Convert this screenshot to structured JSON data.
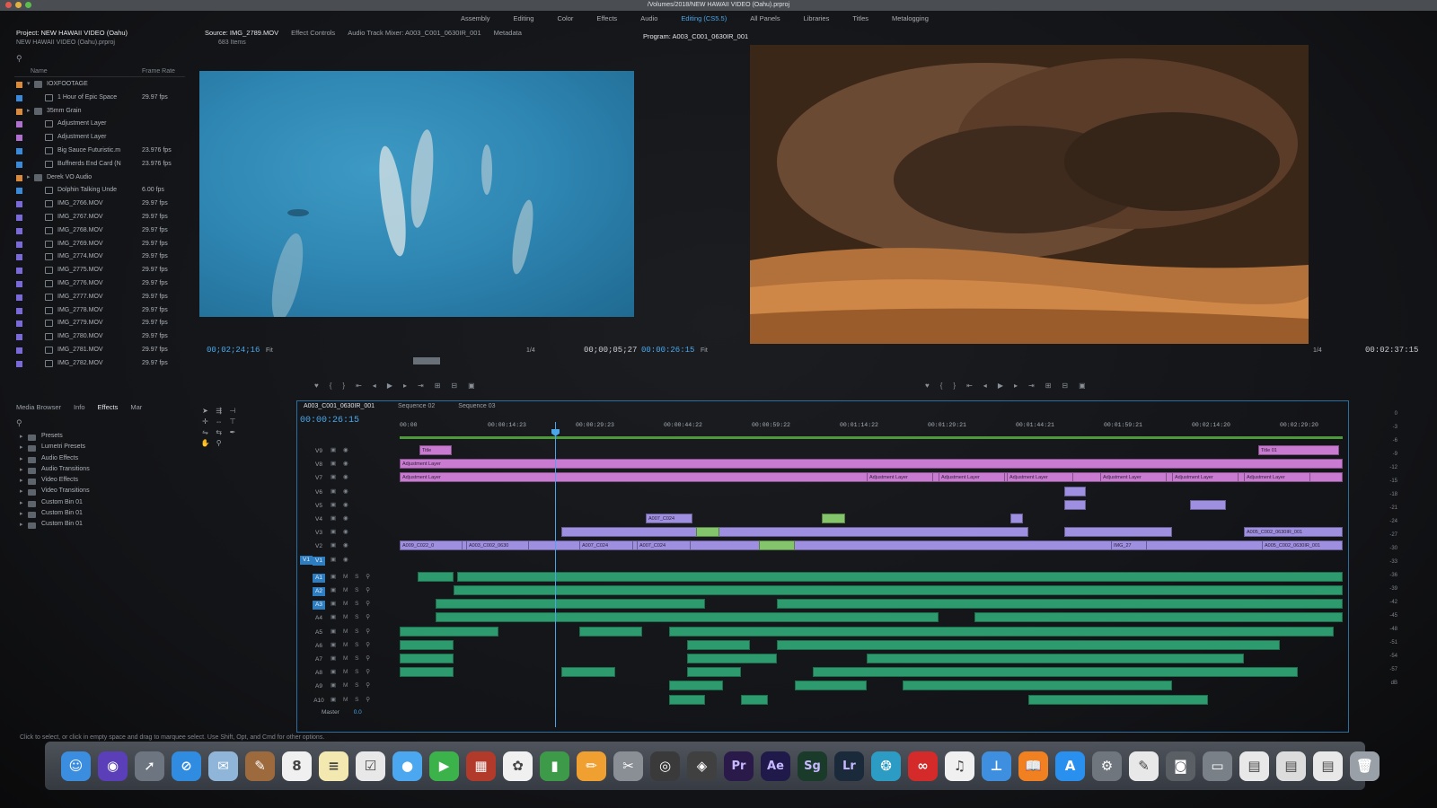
{
  "window": {
    "title": "/Volumes/2018/NEW HAWAII VIDEO (Oahu).prproj"
  },
  "workspaces": [
    "Assembly",
    "Editing",
    "Color",
    "Effects",
    "Audio",
    "Editing (CS5.5)",
    "All Panels",
    "Libraries",
    "Titles",
    "Metalogging"
  ],
  "workspace_active": "Editing (CS5.5)",
  "project": {
    "tab": "Project: NEW HAWAII VIDEO (Oahu)",
    "file": "NEW HAWAII VIDEO (Oahu).prproj",
    "count": "683 Items",
    "col_name": "Name",
    "col_rate": "Frame Rate",
    "items": [
      {
        "name": "IOXFOOTAGE",
        "rate": "",
        "color": "#d98a3a",
        "kind": "bin"
      },
      {
        "name": "1 Hour of Epic Space",
        "rate": "29.97 fps",
        "color": "#3a8ad9",
        "kind": "seq"
      },
      {
        "name": "35mm Grain",
        "rate": "",
        "color": "#d98a3a",
        "kind": "bin"
      },
      {
        "name": "Adjustment Layer",
        "rate": "",
        "color": "#b070d0",
        "kind": "clip"
      },
      {
        "name": "Adjustment Layer",
        "rate": "",
        "color": "#b070d0",
        "kind": "clip"
      },
      {
        "name": "Big Sauce Futuristic.m",
        "rate": "23.976 fps",
        "color": "#3a8ad9",
        "kind": "clip"
      },
      {
        "name": "Buffnerds End Card (N",
        "rate": "23.976 fps",
        "color": "#3a8ad9",
        "kind": "seq"
      },
      {
        "name": "Derek VO Audio",
        "rate": "",
        "color": "#d98a3a",
        "kind": "bin"
      },
      {
        "name": "Dolphin Talking Unde",
        "rate": "6.00 fps",
        "color": "#3a8ad9",
        "kind": "seq"
      },
      {
        "name": "IMG_2766.MOV",
        "rate": "29.97 fps",
        "color": "#7a6ad9",
        "kind": "clip"
      },
      {
        "name": "IMG_2767.MOV",
        "rate": "29.97 fps",
        "color": "#7a6ad9",
        "kind": "clip"
      },
      {
        "name": "IMG_2768.MOV",
        "rate": "29.97 fps",
        "color": "#7a6ad9",
        "kind": "clip"
      },
      {
        "name": "IMG_2769.MOV",
        "rate": "29.97 fps",
        "color": "#7a6ad9",
        "kind": "clip"
      },
      {
        "name": "IMG_2774.MOV",
        "rate": "29.97 fps",
        "color": "#7a6ad9",
        "kind": "clip"
      },
      {
        "name": "IMG_2775.MOV",
        "rate": "29.97 fps",
        "color": "#7a6ad9",
        "kind": "clip"
      },
      {
        "name": "IMG_2776.MOV",
        "rate": "29.97 fps",
        "color": "#7a6ad9",
        "kind": "clip"
      },
      {
        "name": "IMG_2777.MOV",
        "rate": "29.97 fps",
        "color": "#7a6ad9",
        "kind": "clip"
      },
      {
        "name": "IMG_2778.MOV",
        "rate": "29.97 fps",
        "color": "#7a6ad9",
        "kind": "clip"
      },
      {
        "name": "IMG_2779.MOV",
        "rate": "29.97 fps",
        "color": "#7a6ad9",
        "kind": "clip"
      },
      {
        "name": "IMG_2780.MOV",
        "rate": "29.97 fps",
        "color": "#7a6ad9",
        "kind": "clip"
      },
      {
        "name": "IMG_2781.MOV",
        "rate": "29.97 fps",
        "color": "#7a6ad9",
        "kind": "clip"
      },
      {
        "name": "IMG_2782.MOV",
        "rate": "29.97 fps",
        "color": "#7a6ad9",
        "kind": "clip"
      }
    ]
  },
  "source": {
    "tabs": [
      "Source: IMG_2789.MOV",
      "Effect Controls",
      "Audio Track Mixer: A003_C001_0630IR_001",
      "Metadata"
    ],
    "timecode": "00;02;24;16",
    "fit": "Fit",
    "resolution": "1/4",
    "duration": "00;00;05;27"
  },
  "program": {
    "tab": "Program: A003_C001_0630IR_001",
    "timecode": "00:00:26:15",
    "fit": "Fit",
    "resolution": "1/4",
    "duration": "00:02:37:15"
  },
  "effects_panel": {
    "tabs": [
      "Media Browser",
      "Info",
      "Effects",
      "Mar"
    ],
    "active_tab": "Effects",
    "items": [
      "Presets",
      "Lumetri Presets",
      "Audio Effects",
      "Audio Transitions",
      "Video Effects",
      "Video Transitions",
      "Custom Bin 01",
      "Custom Bin 01",
      "Custom Bin 01"
    ]
  },
  "timeline": {
    "tabs": [
      "A003_C001_0630IR_001",
      "Sequence 02",
      "Sequence 03"
    ],
    "active_tab": "A003_C001_0630IR_001",
    "timecode": "00:00:26:15",
    "ruler": [
      "00:00",
      "00:00:14:23",
      "00:00:29:23",
      "00:00:44:22",
      "00:00:59:22",
      "00:01:14:22",
      "00:01:29:21",
      "00:01:44:21",
      "00:01:59:21",
      "00:02:14:20",
      "00:02:29:20"
    ],
    "video_tracks": [
      "V9",
      "V8",
      "V7",
      "V6",
      "V5",
      "V4",
      "V3",
      "V2",
      "V1"
    ],
    "audio_tracks": [
      "A1",
      "A2",
      "A3",
      "A4",
      "A5",
      "A6",
      "A7",
      "A8",
      "A9",
      "A10"
    ],
    "master_label": "Master",
    "master_value": "0.0",
    "clip_labels": {
      "title": "Title",
      "title01": "Title 01",
      "adjustment": "Adjustment Layer",
      "a007": "A007_C024",
      "a009": "A009_C022_0",
      "a003": "A003_C002_0630",
      "img": "IMG_27",
      "a005": "A005_C002_0630IR_001"
    },
    "vu_scale": [
      "0",
      "-3",
      "-6",
      "-9",
      "-12",
      "-15",
      "-18",
      "-21",
      "-24",
      "-27",
      "-30",
      "-33",
      "-36",
      "-39",
      "-42",
      "-45",
      "-48",
      "-51",
      "-54",
      "-57",
      "dB"
    ]
  },
  "status_bar": "Click to select, or click in empty space and drag to marquee select. Use Shift, Opt, and Cmd for other options.",
  "dock": {
    "apps": [
      {
        "name": "finder-icon",
        "glyph": "☺",
        "bg": "#3b8de0"
      },
      {
        "name": "siri-icon",
        "glyph": "◉",
        "bg": "#5a3fb8"
      },
      {
        "name": "launchpad-icon",
        "glyph": "➚",
        "bg": "#6d7580"
      },
      {
        "name": "safari-icon",
        "glyph": "⊘",
        "bg": "#2f8ce0"
      },
      {
        "name": "preview-icon",
        "glyph": "✉",
        "bg": "#8fb5d8"
      },
      {
        "name": "contacts-icon",
        "glyph": "✎",
        "bg": "#9c6a3c"
      },
      {
        "name": "calendar-icon",
        "glyph": "8",
        "bg": "#f0f0f0"
      },
      {
        "name": "notes-icon",
        "glyph": "≡",
        "bg": "#f3e9b0"
      },
      {
        "name": "reminders-icon",
        "glyph": "☑",
        "bg": "#e8e8e8"
      },
      {
        "name": "messages-icon",
        "glyph": "●",
        "bg": "#4aa7f0"
      },
      {
        "name": "facetime-icon",
        "glyph": "▶",
        "bg": "#3cb34a"
      },
      {
        "name": "photo-booth-icon",
        "glyph": "▦",
        "bg": "#b23a2a"
      },
      {
        "name": "photos-icon",
        "glyph": "✿",
        "bg": "#f0f0f0"
      },
      {
        "name": "numbers-icon",
        "glyph": "▮",
        "bg": "#3c9a48"
      },
      {
        "name": "pages-icon",
        "glyph": "✏",
        "bg": "#f0a030"
      },
      {
        "name": "image-capture-icon",
        "glyph": "✂",
        "bg": "#8a8f96"
      },
      {
        "name": "dvd-player-icon",
        "glyph": "◎",
        "bg": "#3a3a3a"
      },
      {
        "name": "photo-browser-icon",
        "glyph": "◈",
        "bg": "#404040"
      },
      {
        "name": "premiere-icon",
        "glyph": "Pr",
        "bg": "#2a1a4a"
      },
      {
        "name": "after-effects-icon",
        "glyph": "Ae",
        "bg": "#1f1a4a"
      },
      {
        "name": "speedgrade-icon",
        "glyph": "Sg",
        "bg": "#1a3a2a"
      },
      {
        "name": "lightroom-icon",
        "glyph": "Lr",
        "bg": "#1a2a3a"
      },
      {
        "name": "creative-cloud-icon",
        "glyph": "❂",
        "bg": "#2c9cc4"
      },
      {
        "name": "adobe-cc-icon",
        "glyph": "∞",
        "bg": "#d42a2a"
      },
      {
        "name": "music-icon",
        "glyph": "♫",
        "bg": "#f0f0f0"
      },
      {
        "name": "keynote-icon",
        "glyph": "⊥",
        "bg": "#3f8fe0"
      },
      {
        "name": "books-icon",
        "glyph": "📖",
        "bg": "#f08020"
      },
      {
        "name": "app-store-icon",
        "glyph": "A",
        "bg": "#2a90ef"
      },
      {
        "name": "system-preferences-icon",
        "glyph": "⚙",
        "bg": "#70767d"
      },
      {
        "name": "textedit-icon",
        "glyph": "✎",
        "bg": "#e8e8e8"
      },
      {
        "name": "camera-icon",
        "glyph": "◙",
        "bg": "#5a5f66"
      },
      {
        "name": "screenshot-icon",
        "glyph": "▭",
        "bg": "#7a8088"
      },
      {
        "name": "document-icon-1",
        "glyph": "▤",
        "bg": "#e8e8e8"
      },
      {
        "name": "document-icon-2",
        "glyph": "▤",
        "bg": "#dcdcdc"
      },
      {
        "name": "document-icon-3",
        "glyph": "▤",
        "bg": "#e8e8e8"
      },
      {
        "name": "trash-icon",
        "glyph": "🗑",
        "bg": "#9aa0a7"
      }
    ]
  }
}
